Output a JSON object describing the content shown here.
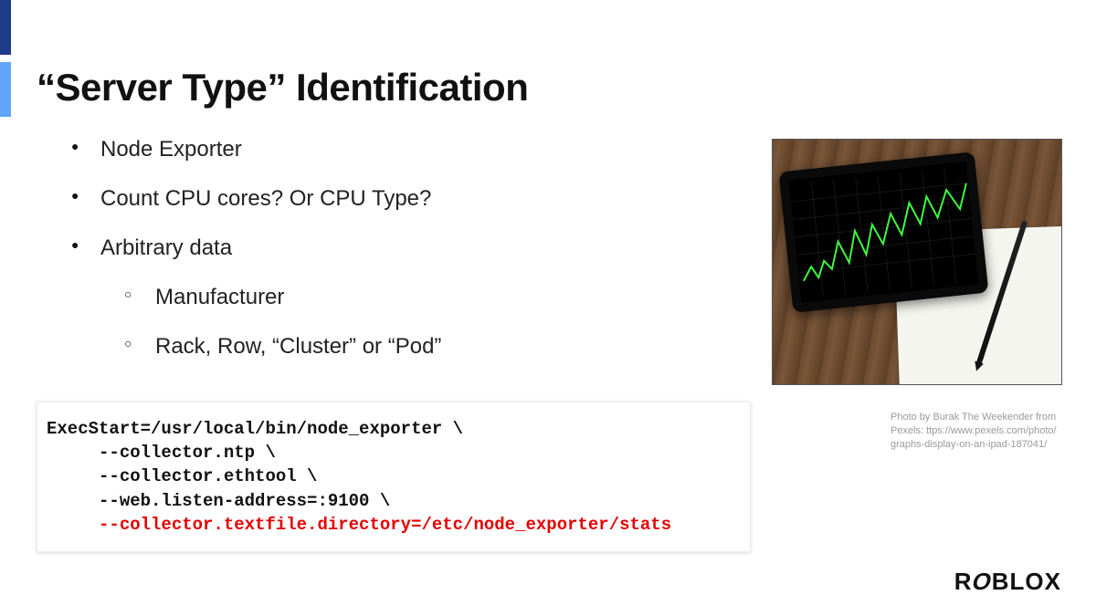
{
  "title": "“Server Type” Identification",
  "bullets": {
    "b1": "Node Exporter",
    "b2": "Count CPU cores? Or CPU Type?",
    "b3": "Arbitrary data",
    "s1": "Manufacturer",
    "s2": "Rack, Row, “Cluster” or “Pod”"
  },
  "code": {
    "l1": "ExecStart=/usr/local/bin/node_exporter \\",
    "l2": "     --collector.ntp \\",
    "l3": "     --collector.ethtool \\",
    "l4": "     --web.listen-address=:9100 \\",
    "l5": "     --collector.textfile.directory=/etc/node_exporter/stats"
  },
  "credit": {
    "line1": "Photo by Burak The Weekender from",
    "line2": "Pexels: ttps://www.pexels.com/photo/",
    "line3": "graphs-display-on-an-ipad-187041/"
  },
  "logo": {
    "text_prefix": "R",
    "text_tilt": "O",
    "text_suffix": "BLOX"
  }
}
